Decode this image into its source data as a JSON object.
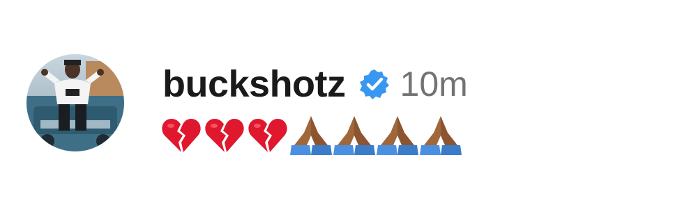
{
  "comment": {
    "username": "buckshotz",
    "verified": true,
    "timestamp": "10m",
    "emojis": [
      "broken-heart",
      "broken-heart",
      "broken-heart",
      "folded-hands",
      "folded-hands",
      "folded-hands",
      "folded-hands"
    ]
  },
  "colors": {
    "username": "#1a1a1a",
    "timestamp": "#737373",
    "verified_badge": "#3897f0",
    "broken_heart": "#e0182d",
    "folded_hands_skin": "#a0673a",
    "folded_hands_sleeve": "#4a90e2"
  },
  "icons": {
    "verified": "verified-badge-icon",
    "broken_heart": "broken-heart-icon",
    "folded_hands": "folded-hands-icon",
    "avatar": "profile-avatar"
  }
}
